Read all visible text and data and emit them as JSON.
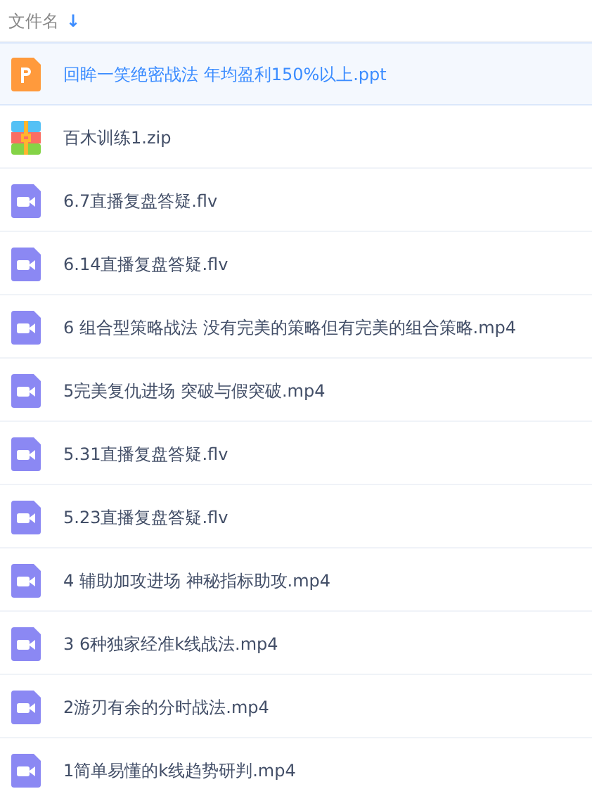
{
  "header": {
    "label": "文件名",
    "sort_icon": "↓"
  },
  "files": [
    {
      "name": "回眸一笑绝密战法 年均盈利150%以上.ppt",
      "kind": "ppt",
      "selected": true
    },
    {
      "name": "百木训练1.zip",
      "kind": "zip",
      "selected": false
    },
    {
      "name": "6.7直播复盘答疑.flv",
      "kind": "video",
      "selected": false
    },
    {
      "name": "6.14直播复盘答疑.flv",
      "kind": "video",
      "selected": false
    },
    {
      "name": "6 组合型策略战法 没有完美的策略但有完美的组合策略.mp4",
      "kind": "video",
      "selected": false
    },
    {
      "name": "5完美复仇进场 突破与假突破.mp4",
      "kind": "video",
      "selected": false
    },
    {
      "name": "5.31直播复盘答疑.flv",
      "kind": "video",
      "selected": false
    },
    {
      "name": "5.23直播复盘答疑.flv",
      "kind": "video",
      "selected": false
    },
    {
      "name": "4 辅助加攻进场 神秘指标助攻.mp4",
      "kind": "video",
      "selected": false
    },
    {
      "name": "3 6种独家经准k线战法.mp4",
      "kind": "video",
      "selected": false
    },
    {
      "name": "2游刃有余的分时战法.mp4",
      "kind": "video",
      "selected": false
    },
    {
      "name": "1简单易懂的k线趋势研判.mp4",
      "kind": "video",
      "selected": false
    }
  ]
}
